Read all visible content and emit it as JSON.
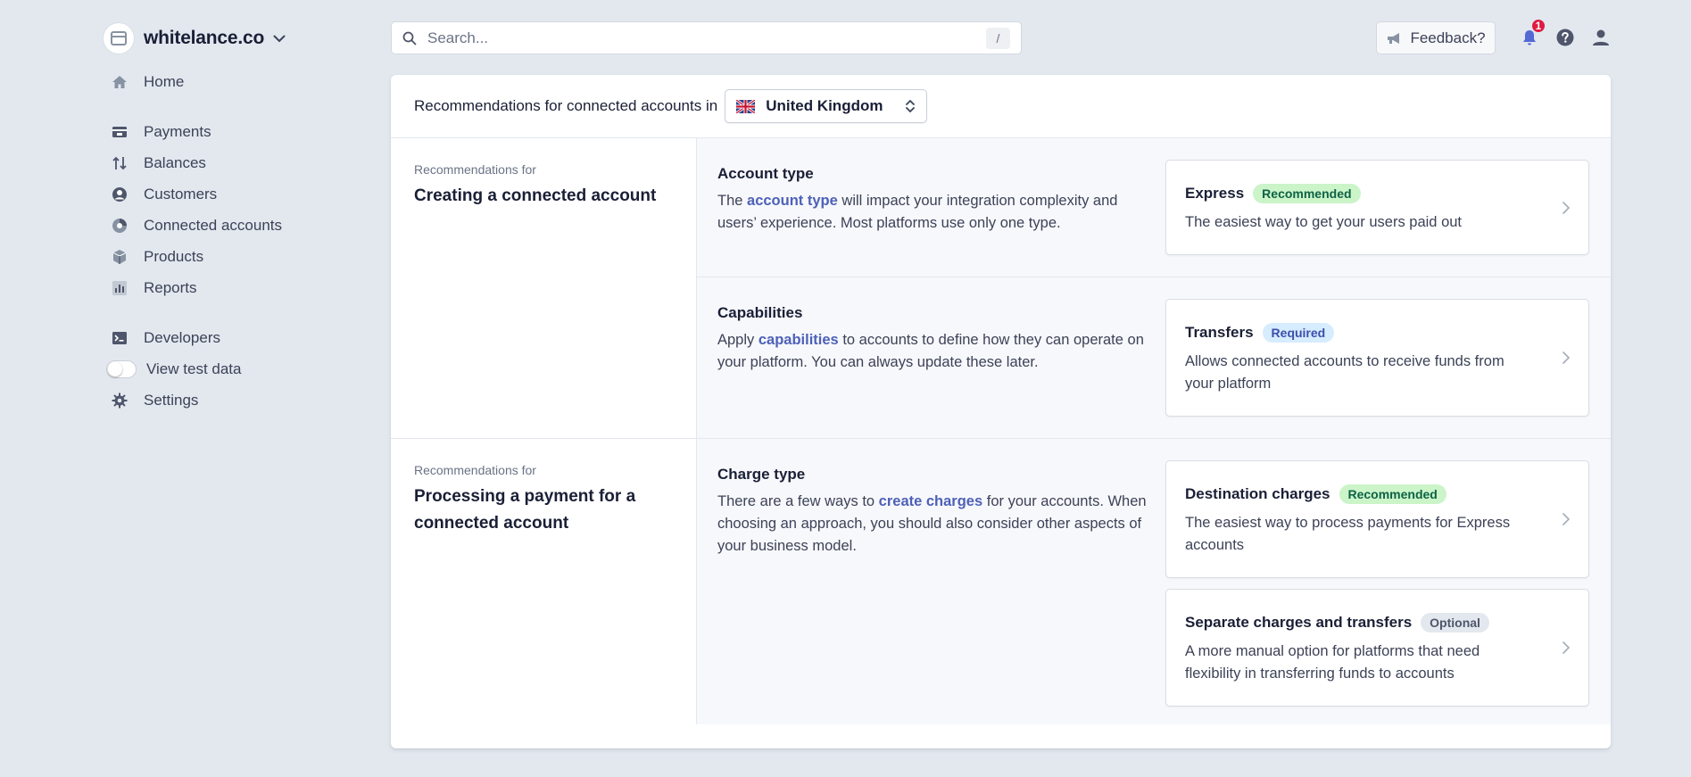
{
  "account": {
    "name": "whitelance.co"
  },
  "nav": {
    "home": "Home",
    "payments": "Payments",
    "balances": "Balances",
    "customers": "Customers",
    "connected_accounts": "Connected accounts",
    "products": "Products",
    "reports": "Reports",
    "developers": "Developers",
    "view_test_data": "View test data",
    "settings": "Settings"
  },
  "search": {
    "placeholder": "Search...",
    "shortcut": "/"
  },
  "topbar": {
    "feedback_label": "Feedback?",
    "notification_count": "1"
  },
  "header": {
    "label": "Recommendations for connected accounts in",
    "country": "United Kingdom"
  },
  "sections": [
    {
      "kicker": "Recommendations for",
      "title": "Creating a connected account",
      "rows": [
        {
          "title": "Account type",
          "desc_pre": "The ",
          "link": "account type",
          "desc_post": " will impact your integration complexity and users’ experience. Most platforms use only one type.",
          "options": [
            {
              "title": "Express",
              "badge": "Recommended",
              "desc": "The easiest way to get your users paid out"
            }
          ]
        },
        {
          "title": "Capabilities",
          "desc_pre": "Apply ",
          "link": "capabilities",
          "desc_post": " to accounts to define how they can operate on your platform. You can always update these later.",
          "options": [
            {
              "title": "Transfers",
              "badge": "Required",
              "desc": "Allows connected accounts to receive funds from your platform"
            }
          ]
        }
      ]
    },
    {
      "kicker": "Recommendations for",
      "title": "Processing a payment for a connected account",
      "rows": [
        {
          "title": "Charge type",
          "desc_pre": "There are a few ways to ",
          "link": "create charges",
          "desc_post": " for your accounts. When choosing an approach, you should also consider other aspects of your business model.",
          "options": [
            {
              "title": "Destination charges",
              "badge": "Recommended",
              "desc": "The easiest way to process payments for Express accounts"
            },
            {
              "title": "Separate charges and transfers",
              "badge": "Optional",
              "desc": "A more manual option for platforms that need flexibility in transferring funds to accounts"
            }
          ]
        }
      ]
    }
  ],
  "colors": {
    "background": "#e3e8ef",
    "link": "#4d61b8",
    "badge_recommended_bg": "#cbf4c9",
    "badge_required_bg": "#d6ecff",
    "badge_optional_bg": "#e3e8ee",
    "notification": "#df1b41"
  }
}
